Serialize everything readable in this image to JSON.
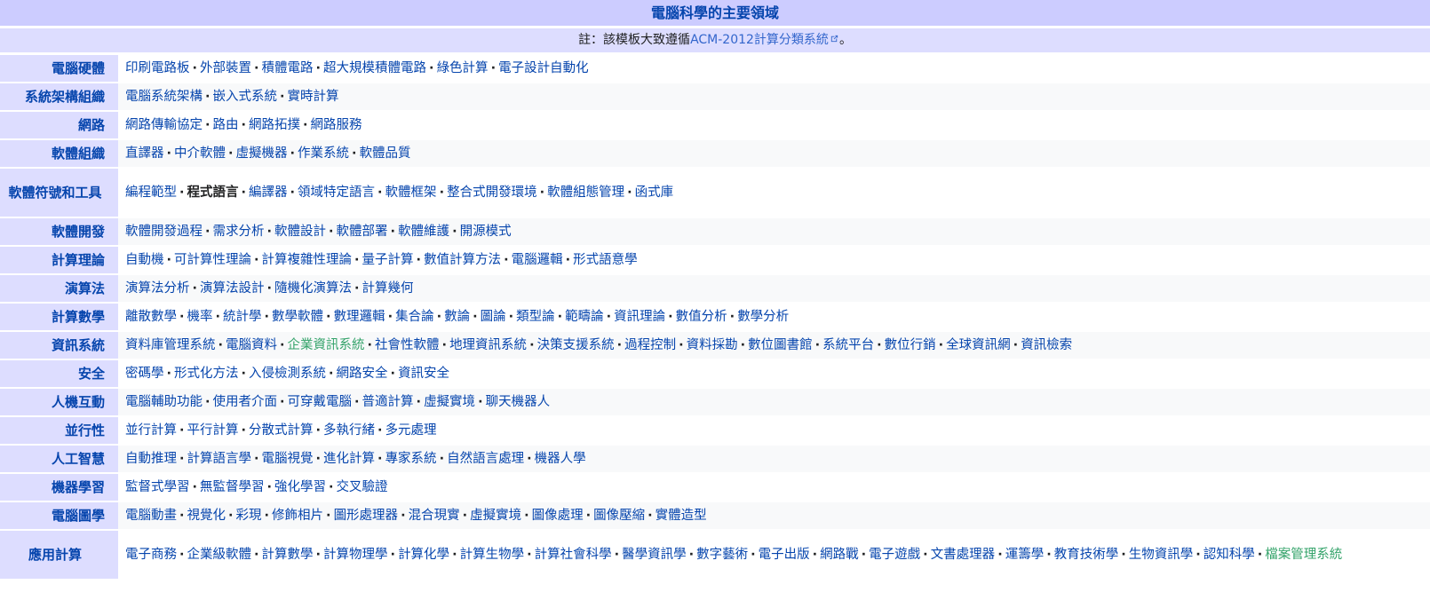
{
  "title": "電腦科學的主要領域",
  "note": {
    "prefix": "註：該模板大致遵循",
    "link": "ACM-2012計算分類系統",
    "suffix": "。"
  },
  "rows": [
    {
      "group": "電腦硬體",
      "items": [
        {
          "text": "印刷電路板"
        },
        {
          "text": "外部裝置"
        },
        {
          "text": "積體電路"
        },
        {
          "text": "超大規模積體電路"
        },
        {
          "text": "綠色計算"
        },
        {
          "text": "電子設計自動化"
        }
      ]
    },
    {
      "group": "系統架構組織",
      "items": [
        {
          "text": "電腦系統架構"
        },
        {
          "text": "嵌入式系統"
        },
        {
          "text": "實時計算"
        }
      ]
    },
    {
      "group": "網路",
      "items": [
        {
          "text": "網路傳輸協定"
        },
        {
          "text": "路由"
        },
        {
          "text": "網路拓撲"
        },
        {
          "text": "網路服務"
        }
      ]
    },
    {
      "group": "軟體組織",
      "items": [
        {
          "text": "直譯器"
        },
        {
          "text": "中介軟體"
        },
        {
          "text": "虛擬機器"
        },
        {
          "text": "作業系統"
        },
        {
          "text": "軟體品質"
        }
      ]
    },
    {
      "group": "軟體符號和工具",
      "items": [
        {
          "text": "編程範型"
        },
        {
          "text": "程式語言",
          "bold": true
        },
        {
          "text": "編譯器"
        },
        {
          "text": "領域特定語言"
        },
        {
          "text": "軟體框架"
        },
        {
          "text": "整合式開發環境"
        },
        {
          "text": "軟體組態管理"
        },
        {
          "text": "函式庫"
        }
      ]
    },
    {
      "group": "軟體開發",
      "items": [
        {
          "text": "軟體開發過程"
        },
        {
          "text": "需求分析"
        },
        {
          "text": "軟體設計"
        },
        {
          "text": "軟體部署"
        },
        {
          "text": "軟體維護"
        },
        {
          "text": "開源模式"
        }
      ]
    },
    {
      "group": "計算理論",
      "items": [
        {
          "text": "自動機"
        },
        {
          "text": "可計算性理論"
        },
        {
          "text": "計算複雜性理論"
        },
        {
          "text": "量子計算"
        },
        {
          "text": "數值計算方法"
        },
        {
          "text": "電腦邏輯"
        },
        {
          "text": "形式語意學"
        }
      ]
    },
    {
      "group": "演算法",
      "items": [
        {
          "text": "演算法分析"
        },
        {
          "text": "演算法設計"
        },
        {
          "text": "隨機化演算法"
        },
        {
          "text": "計算幾何"
        }
      ]
    },
    {
      "group": "計算數學",
      "items": [
        {
          "text": "離散數學"
        },
        {
          "text": "機率"
        },
        {
          "text": "統計學"
        },
        {
          "text": "數學軟體"
        },
        {
          "text": "數理邏輯"
        },
        {
          "text": "集合論"
        },
        {
          "text": "數論"
        },
        {
          "text": "圖論"
        },
        {
          "text": "類型論"
        },
        {
          "text": "範疇論"
        },
        {
          "text": "資訊理論"
        },
        {
          "text": "數值分析"
        },
        {
          "text": "數學分析"
        }
      ]
    },
    {
      "group": "資訊系統",
      "items": [
        {
          "text": "資料庫管理系統"
        },
        {
          "text": "電腦資料"
        },
        {
          "text": "企業資訊系統",
          "green": true
        },
        {
          "text": "社會性軟體"
        },
        {
          "text": "地理資訊系統"
        },
        {
          "text": "決策支援系統"
        },
        {
          "text": "過程控制"
        },
        {
          "text": "資料採勘"
        },
        {
          "text": "數位圖書館"
        },
        {
          "text": "系統平台"
        },
        {
          "text": "數位行銷"
        },
        {
          "text": "全球資訊網"
        },
        {
          "text": "資訊檢索"
        }
      ]
    },
    {
      "group": "安全",
      "items": [
        {
          "text": "密碼學"
        },
        {
          "text": "形式化方法"
        },
        {
          "text": "入侵檢測系統"
        },
        {
          "text": "網路安全"
        },
        {
          "text": "資訊安全"
        }
      ]
    },
    {
      "group": "人機互動",
      "items": [
        {
          "text": "電腦輔助功能"
        },
        {
          "text": "使用者介面"
        },
        {
          "text": "可穿戴電腦"
        },
        {
          "text": "普適計算"
        },
        {
          "text": "虛擬實境"
        },
        {
          "text": "聊天機器人"
        }
      ]
    },
    {
      "group": "並行性",
      "items": [
        {
          "text": "並行計算"
        },
        {
          "text": "平行計算"
        },
        {
          "text": "分散式計算"
        },
        {
          "text": "多執行緒"
        },
        {
          "text": "多元處理"
        }
      ]
    },
    {
      "group": "人工智慧",
      "items": [
        {
          "text": "自動推理"
        },
        {
          "text": "計算語言學"
        },
        {
          "text": "電腦視覺"
        },
        {
          "text": "進化計算"
        },
        {
          "text": "專家系統"
        },
        {
          "text": "自然語言處理"
        },
        {
          "text": "機器人學"
        }
      ]
    },
    {
      "group": "機器學習",
      "items": [
        {
          "text": "監督式學習"
        },
        {
          "text": "無監督學習"
        },
        {
          "text": "強化學習"
        },
        {
          "text": "交叉驗證"
        }
      ]
    },
    {
      "group": "電腦圖學",
      "items": [
        {
          "text": "電腦動畫"
        },
        {
          "text": "視覺化"
        },
        {
          "text": "彩現"
        },
        {
          "text": "修飾相片"
        },
        {
          "text": "圖形處理器"
        },
        {
          "text": "混合現實"
        },
        {
          "text": "虛擬實境"
        },
        {
          "text": "圖像處理"
        },
        {
          "text": "圖像壓縮"
        },
        {
          "text": "實體造型"
        }
      ]
    },
    {
      "group": "應用計算",
      "items": [
        {
          "text": "電子商務"
        },
        {
          "text": "企業級軟體"
        },
        {
          "text": "計算數學"
        },
        {
          "text": "計算物理學"
        },
        {
          "text": "計算化學"
        },
        {
          "text": "計算生物學"
        },
        {
          "text": "計算社會科學"
        },
        {
          "text": "醫學資訊學"
        },
        {
          "text": "數字藝術"
        },
        {
          "text": "電子出版"
        },
        {
          "text": "網路戰"
        },
        {
          "text": "電子遊戲"
        },
        {
          "text": "文書處理器"
        },
        {
          "text": "運籌學"
        },
        {
          "text": "教育技術學"
        },
        {
          "text": "生物資訊學"
        },
        {
          "text": "認知科學"
        },
        {
          "text": "檔案管理系統",
          "green": true
        }
      ]
    }
  ]
}
